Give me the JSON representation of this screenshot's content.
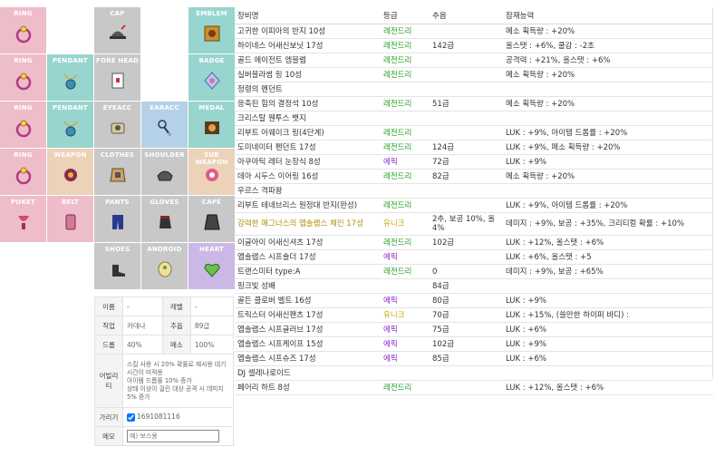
{
  "equipment_slots": [
    {
      "label": "RING",
      "color": "pink",
      "col": 0,
      "row": 0,
      "icon": "ring-icon"
    },
    {
      "label": "CAP",
      "color": "gray",
      "col": 2,
      "row": 0,
      "icon": "cap-icon"
    },
    {
      "label": "EMBLEM",
      "color": "teal",
      "col": 4,
      "row": 0,
      "icon": "emblem-icon"
    },
    {
      "label": "RING",
      "color": "pink",
      "col": 0,
      "row": 1,
      "icon": "ring-icon"
    },
    {
      "label": "PENDANT",
      "color": "teal",
      "col": 1,
      "row": 1,
      "icon": "pendant-icon"
    },
    {
      "label": "FORE HEAD",
      "color": "gray",
      "col": 2,
      "row": 1,
      "icon": "forehead-icon"
    },
    {
      "label": "BADGE",
      "color": "teal",
      "col": 4,
      "row": 1,
      "icon": "badge-icon"
    },
    {
      "label": "RING",
      "color": "pink",
      "col": 0,
      "row": 2,
      "icon": "ring-icon"
    },
    {
      "label": "PENDANT",
      "color": "teal",
      "col": 1,
      "row": 2,
      "icon": "pendant-icon"
    },
    {
      "label": "EYEACC",
      "color": "gray",
      "col": 2,
      "row": 2,
      "icon": "eye-accessory-icon"
    },
    {
      "label": "EARACC",
      "color": "blue",
      "col": 3,
      "row": 2,
      "icon": "earring-icon"
    },
    {
      "label": "MEDAL",
      "color": "teal",
      "col": 4,
      "row": 2,
      "icon": "medal-icon"
    },
    {
      "label": "RING",
      "color": "pink",
      "col": 0,
      "row": 3,
      "icon": "ring-icon"
    },
    {
      "label": "WEAPON",
      "color": "peach",
      "col": 1,
      "row": 3,
      "icon": "weapon-icon"
    },
    {
      "label": "CLOTHES",
      "color": "gray",
      "col": 2,
      "row": 3,
      "icon": "clothes-icon"
    },
    {
      "label": "SHOULDER",
      "color": "gray",
      "col": 3,
      "row": 3,
      "icon": "shoulder-icon"
    },
    {
      "label": "SUB WEAPON",
      "color": "peach",
      "col": 4,
      "row": 3,
      "icon": "sub-weapon-icon"
    },
    {
      "label": "POKET",
      "color": "pink",
      "col": 0,
      "row": 4,
      "icon": "pocket-icon"
    },
    {
      "label": "BELT",
      "color": "pink",
      "col": 1,
      "row": 4,
      "icon": "belt-icon"
    },
    {
      "label": "PANTS",
      "color": "gray",
      "col": 2,
      "row": 4,
      "icon": "pants-icon"
    },
    {
      "label": "GLOVES",
      "color": "gray",
      "col": 3,
      "row": 4,
      "icon": "gloves-icon"
    },
    {
      "label": "CAPE",
      "color": "gray",
      "col": 4,
      "row": 4,
      "icon": "cape-icon"
    },
    {
      "label": "SHOES",
      "color": "gray",
      "col": 2,
      "row": 5,
      "icon": "shoes-icon"
    },
    {
      "label": "ANDROID",
      "color": "gray",
      "col": 3,
      "row": 5,
      "icon": "android-icon"
    },
    {
      "label": "HEART",
      "color": "purple",
      "col": 4,
      "row": 5,
      "icon": "heart-icon"
    }
  ],
  "char_info": {
    "name_key": "이름",
    "name_val": "-",
    "level_key": "레벨",
    "level_val": "-",
    "job_key": "직업",
    "job_val": "카데나",
    "star_key": "추옵",
    "star_val": "89급",
    "drop_key": "드롭",
    "drop_val": "40%",
    "meso_key": "메소",
    "meso_val": "100%",
    "ability_key": "어빌리티",
    "ability_lines": [
      "스킬 사용 시 20% 확률로 재사용 대기시간이 미적용",
      "아이템 드롭률 10% 증가",
      "상태 이상이 걸린 대상 공격 시 데미지 5% 증가"
    ],
    "hide_key": "가리기",
    "hide_val": "1691081116",
    "memo_key": "메모",
    "memo_placeholder": "예) 보스용"
  },
  "item_table": {
    "headers": [
      "장비명",
      "등급",
      "추옵",
      "잠재능력"
    ],
    "rows": [
      {
        "name": "고귀한 이피아의 반지 10성",
        "grade": "레전드리",
        "gclass": "g-legend",
        "star": "",
        "potential": "메소 획득량 : +20%"
      },
      {
        "name": "하이네스 어새신보닛 17성",
        "grade": "레전드리",
        "gclass": "g-legend",
        "star": "142급",
        "potential": "올스탯 : +6%, 쿨감 : -2초"
      },
      {
        "name": "골드 에이전트 엠블렘",
        "grade": "레전드리",
        "gclass": "g-legend",
        "star": "",
        "potential": "공격력 : +21%, 올스탯 : +6%"
      },
      {
        "name": "실버블라썸 링 10성",
        "grade": "레전드리",
        "gclass": "g-legend",
        "star": "",
        "potential": "메소 획득량 : +20%"
      },
      {
        "name": "정령의 펜던트",
        "grade": "",
        "gclass": "",
        "star": "",
        "potential": ""
      },
      {
        "name": "응축된 힘의 결정석 10성",
        "grade": "레전드리",
        "gclass": "g-legend",
        "star": "51급",
        "potential": "메소 획득량 : +20%"
      },
      {
        "name": "크리스탈 웬투스 뱃지",
        "grade": "",
        "gclass": "",
        "star": "",
        "potential": ""
      },
      {
        "name": "리부트 어웨이크 링(4단계)",
        "grade": "레전드리",
        "gclass": "g-legend",
        "star": "",
        "potential": "LUK : +9%, 아이템 드롭률 : +20%"
      },
      {
        "name": "도미네이터 펜던트 17성",
        "grade": "레전드리",
        "gclass": "g-legend",
        "star": "124급",
        "potential": "LUK : +9%, 메소 획득량 : +20%"
      },
      {
        "name": "아쿠아틱 레터 눈장식 8성",
        "grade": "에픽",
        "gclass": "g-epic",
        "star": "72급",
        "potential": "LUK : +9%"
      },
      {
        "name": "데아 시두스 이어링 16성",
        "grade": "레전드리",
        "gclass": "g-legend",
        "star": "82급",
        "potential": "메소 획득량 : +20%"
      },
      {
        "name": "우르스 격파왕",
        "grade": "",
        "gclass": "",
        "star": "",
        "potential": ""
      },
      {
        "name": "리부트 테네브리스 원정대 반지(완성)",
        "grade": "레전드리",
        "gclass": "g-legend",
        "star": "",
        "potential": "LUK : +9%, 아이템 드롭률 : +20%"
      },
      {
        "name": "강력한 매그너스의 앱솔랩스 체인 17성",
        "grade": "유니크",
        "gclass": "g-unique",
        "nclass": "n-unique",
        "star": "2추, 보공 10%, 올 4%",
        "potential": "데미지 : +9%, 보공 : +35%, 크리티컬 확률 : +10%",
        "tall": true
      },
      {
        "name": "이글아이 어새신셔츠 17성",
        "grade": "레전드리",
        "gclass": "g-legend",
        "star": "102급",
        "potential": "LUK : +12%, 올스탯 : +6%"
      },
      {
        "name": "앱솔랩스 시프숄더 17성",
        "grade": "에픽",
        "gclass": "g-epic",
        "star": "",
        "potential": "LUK : +6%, 올스탯 : +5"
      },
      {
        "name": "트랜스미터 type:A",
        "grade": "레전드리",
        "gclass": "g-legend",
        "star": "0",
        "potential": "데미지 : +9%, 보공 : +65%"
      },
      {
        "name": "핑크빛 성배",
        "grade": "",
        "gclass": "",
        "star": "84급",
        "potential": ""
      },
      {
        "name": "골든 클로버 벨트 16성",
        "grade": "에픽",
        "gclass": "g-epic",
        "star": "80급",
        "potential": "LUK : +9%"
      },
      {
        "name": "트릭스터 어새신팬츠 17성",
        "grade": "유니크",
        "gclass": "g-unique",
        "star": "70급",
        "potential": "LUK : +15%, (쓸만한 하이퍼 바디) :"
      },
      {
        "name": "앱솔랩스 시프글러브 17성",
        "grade": "에픽",
        "gclass": "g-epic",
        "star": "75급",
        "potential": "LUK : +6%"
      },
      {
        "name": "앱솔랩스 시프케이프 15성",
        "grade": "에픽",
        "gclass": "g-epic",
        "star": "102급",
        "potential": "LUK : +9%"
      },
      {
        "name": "앱솔랩스 시프슈즈 17성",
        "grade": "에픽",
        "gclass": "g-epic",
        "star": "85급",
        "potential": "LUK : +6%"
      },
      {
        "name": "DJ 셀레나로이드",
        "grade": "",
        "gclass": "",
        "star": "",
        "potential": ""
      },
      {
        "name": "페어리 하트 8성",
        "grade": "레전드리",
        "gclass": "g-legend",
        "star": "",
        "potential": "LUK : +12%, 올스탯 : +6%"
      }
    ]
  }
}
